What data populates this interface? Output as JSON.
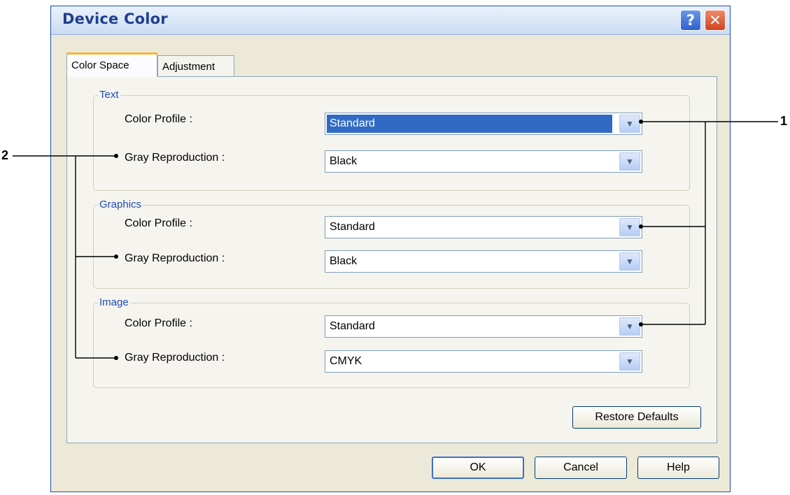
{
  "window": {
    "title": "Device Color",
    "help_button": "?",
    "close_button": "✕"
  },
  "tabs": [
    {
      "label": "Color Space",
      "active": true
    },
    {
      "label": "Adjustment",
      "active": false
    }
  ],
  "groups": {
    "text": {
      "title": "Text",
      "color_profile_label": "Color Profile :",
      "color_profile_value": "Standard",
      "gray_label": "Gray Reproduction :",
      "gray_value": "Black"
    },
    "graphics": {
      "title": "Graphics",
      "color_profile_label": "Color Profile :",
      "color_profile_value": "Standard",
      "gray_label": "Gray Reproduction :",
      "gray_value": "Black"
    },
    "image": {
      "title": "Image",
      "color_profile_label": "Color Profile :",
      "color_profile_value": "Standard",
      "gray_label": "Gray Reproduction :",
      "gray_value": "CMYK"
    }
  },
  "buttons": {
    "restore_defaults": "Restore Defaults",
    "ok": "OK",
    "cancel": "Cancel",
    "help": "Help"
  },
  "callouts": {
    "one": "1",
    "two": "2"
  },
  "icons": {
    "dropdown": "chevron-down-icon",
    "help": "question-icon",
    "close": "close-icon"
  },
  "colors": {
    "title_text": "#1f3f8f",
    "group_title": "#1f4bb6",
    "selection": "#316ac5",
    "tab_accent": "#f7b536"
  }
}
